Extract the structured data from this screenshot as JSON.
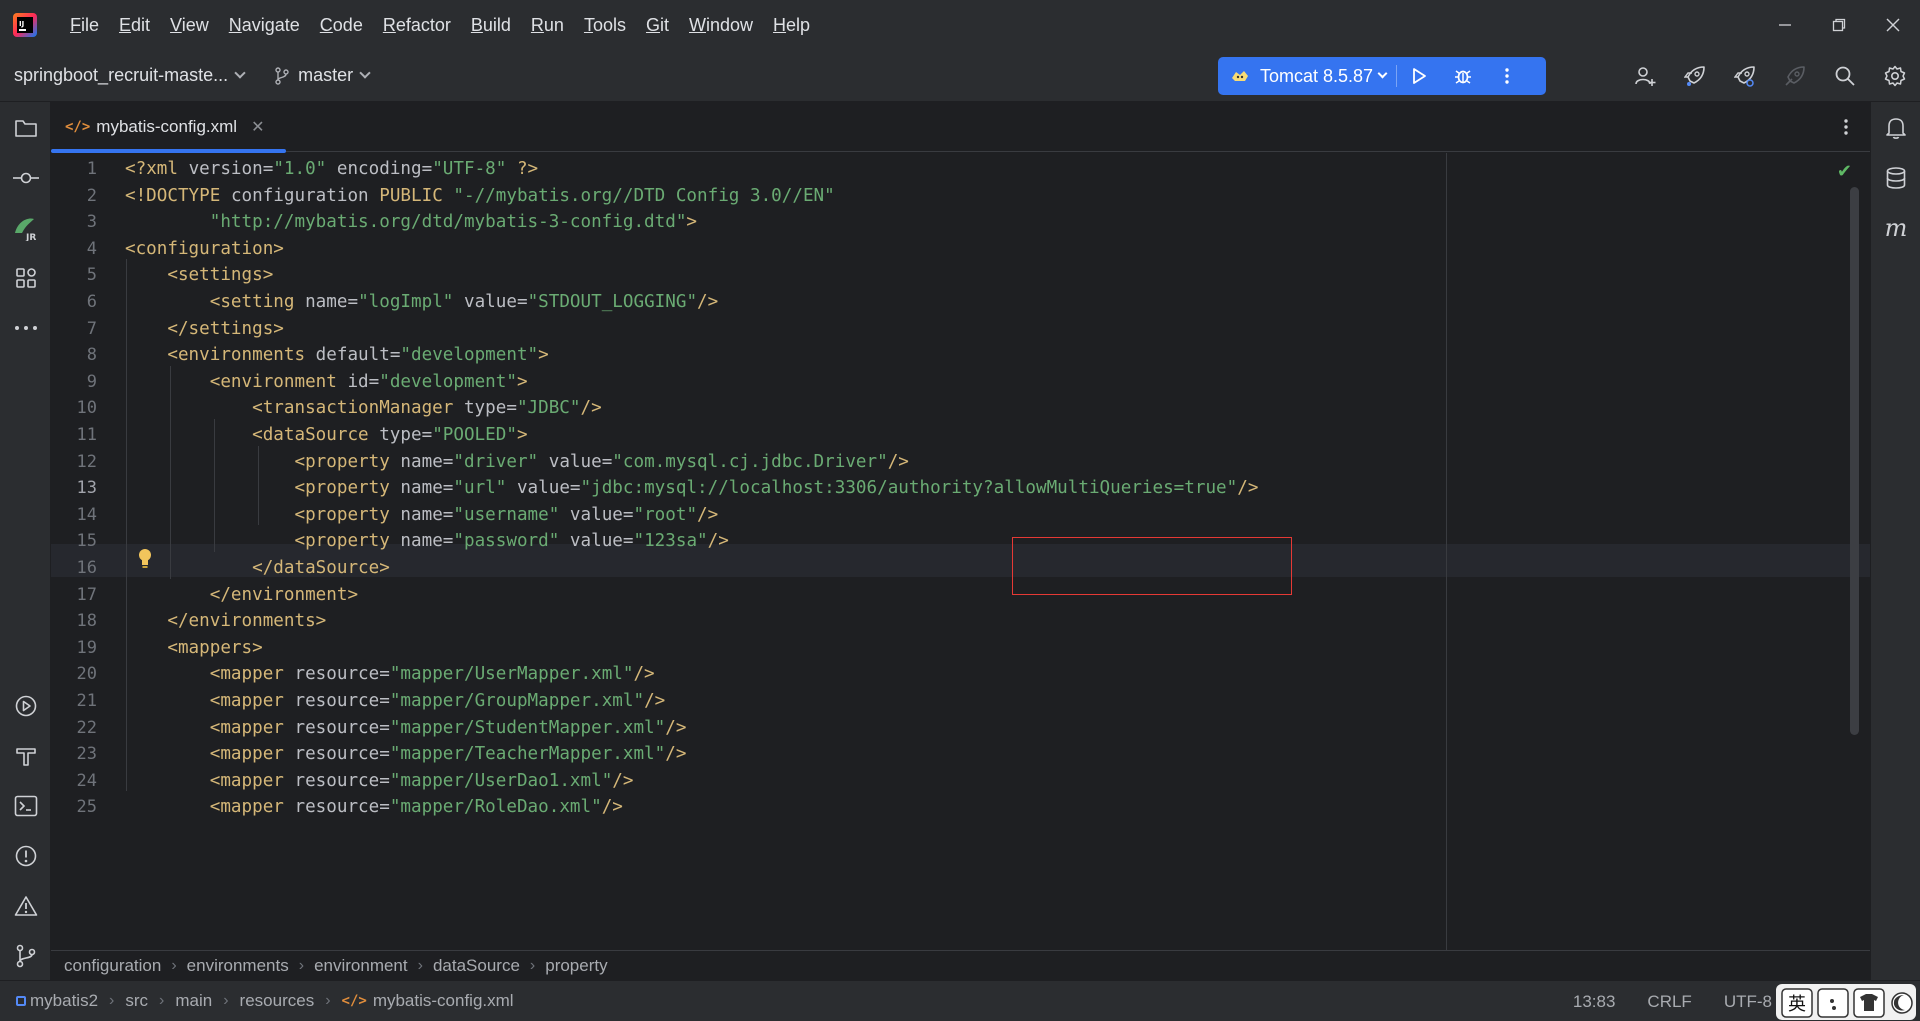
{
  "menu": {
    "items": [
      {
        "mnemonic": "F",
        "rest": "ile"
      },
      {
        "mnemonic": "E",
        "rest": "dit"
      },
      {
        "mnemonic": "V",
        "rest": "iew"
      },
      {
        "mnemonic": "N",
        "rest": "avigate"
      },
      {
        "mnemonic": "C",
        "rest": "ode"
      },
      {
        "mnemonic": "R",
        "rest": "efactor"
      },
      {
        "mnemonic": "B",
        "rest": "uild"
      },
      {
        "mnemonic": "R",
        "rest": "un"
      },
      {
        "mnemonic": "T",
        "rest": "ools"
      },
      {
        "mnemonic": "G",
        "rest": "it"
      },
      {
        "mnemonic": "W",
        "rest": "indow"
      },
      {
        "mnemonic": "H",
        "rest": "elp"
      }
    ]
  },
  "toolbar": {
    "project_name": "springboot_recruit-maste...",
    "branch": "master",
    "run_config": "Tomcat 8.5.87"
  },
  "tabs": {
    "active_label": "mybatis-config.xml"
  },
  "editor": {
    "current_line": 13,
    "code": [
      [
        [
          "pun",
          "<?"
        ],
        [
          "tag",
          "xml "
        ],
        [
          "attr",
          "version"
        ],
        [
          "txt",
          "="
        ],
        [
          "val",
          "\"1.0\""
        ],
        [
          "txt",
          " "
        ],
        [
          "attr",
          "encoding"
        ],
        [
          "txt",
          "="
        ],
        [
          "val",
          "\"UTF-8\""
        ],
        [
          "txt",
          " "
        ],
        [
          "pun",
          "?>"
        ]
      ],
      [
        [
          "tag",
          "<!DOCTYPE "
        ],
        [
          "txt",
          "configuration "
        ],
        [
          "tag",
          "PUBLIC "
        ],
        [
          "val",
          "\"-//mybatis.org//DTD Config 3.0//EN\""
        ]
      ],
      [
        [
          "txt",
          "        "
        ],
        [
          "val",
          "\"http://mybatis.org/dtd/mybatis-3-config.dtd\""
        ],
        [
          "tag",
          ">"
        ]
      ],
      [
        [
          "tag",
          "<configuration>"
        ]
      ],
      [
        [
          "txt",
          "    "
        ],
        [
          "tag",
          "<settings>"
        ]
      ],
      [
        [
          "txt",
          "        "
        ],
        [
          "tag",
          "<setting "
        ],
        [
          "attr",
          "name"
        ],
        [
          "txt",
          "="
        ],
        [
          "val",
          "\"logImpl\""
        ],
        [
          "txt",
          " "
        ],
        [
          "attr",
          "value"
        ],
        [
          "txt",
          "="
        ],
        [
          "val",
          "\"STDOUT_LOGGING\""
        ],
        [
          "tag",
          "/>"
        ]
      ],
      [
        [
          "txt",
          "    "
        ],
        [
          "tag",
          "</settings>"
        ]
      ],
      [
        [
          "txt",
          "    "
        ],
        [
          "tag",
          "<environments "
        ],
        [
          "attr",
          "default"
        ],
        [
          "txt",
          "="
        ],
        [
          "val",
          "\"development\""
        ],
        [
          "tag",
          ">"
        ]
      ],
      [
        [
          "txt",
          "        "
        ],
        [
          "tag",
          "<environment "
        ],
        [
          "attr",
          "id"
        ],
        [
          "txt",
          "="
        ],
        [
          "val",
          "\"development\""
        ],
        [
          "tag",
          ">"
        ]
      ],
      [
        [
          "txt",
          "            "
        ],
        [
          "tag",
          "<transactionManager "
        ],
        [
          "attr",
          "type"
        ],
        [
          "txt",
          "="
        ],
        [
          "val",
          "\"JDBC\""
        ],
        [
          "tag",
          "/>"
        ]
      ],
      [
        [
          "txt",
          "            "
        ],
        [
          "tag",
          "<dataSource "
        ],
        [
          "attr",
          "type"
        ],
        [
          "txt",
          "="
        ],
        [
          "val",
          "\"POOLED\""
        ],
        [
          "tag",
          ">"
        ]
      ],
      [
        [
          "txt",
          "                "
        ],
        [
          "tag",
          "<property "
        ],
        [
          "attr",
          "name"
        ],
        [
          "txt",
          "="
        ],
        [
          "val",
          "\"driver\""
        ],
        [
          "txt",
          " "
        ],
        [
          "attr",
          "value"
        ],
        [
          "txt",
          "="
        ],
        [
          "val",
          "\"com.mysql.cj.jdbc.Driver\""
        ],
        [
          "tag",
          "/>"
        ]
      ],
      [
        [
          "txt",
          "                "
        ],
        [
          "tag",
          "<property "
        ],
        [
          "attr",
          "name"
        ],
        [
          "txt",
          "="
        ],
        [
          "val",
          "\"url\""
        ],
        [
          "txt",
          " "
        ],
        [
          "attr",
          "value"
        ],
        [
          "txt",
          "="
        ],
        [
          "val",
          "\"jdbc:mysql://localhost:3306/authority?allowMultiQueries=true\""
        ],
        [
          "tag",
          "/>"
        ]
      ],
      [
        [
          "txt",
          "                "
        ],
        [
          "tag",
          "<property "
        ],
        [
          "attr",
          "name"
        ],
        [
          "txt",
          "="
        ],
        [
          "val",
          "\"username\""
        ],
        [
          "txt",
          " "
        ],
        [
          "attr",
          "value"
        ],
        [
          "txt",
          "="
        ],
        [
          "val",
          "\"root\""
        ],
        [
          "tag",
          "/>"
        ]
      ],
      [
        [
          "txt",
          "                "
        ],
        [
          "tag",
          "<property "
        ],
        [
          "attr",
          "name"
        ],
        [
          "txt",
          "="
        ],
        [
          "val",
          "\"password\""
        ],
        [
          "txt",
          " "
        ],
        [
          "attr",
          "value"
        ],
        [
          "txt",
          "="
        ],
        [
          "val",
          "\"123sa\""
        ],
        [
          "tag",
          "/>"
        ]
      ],
      [
        [
          "txt",
          "            "
        ],
        [
          "tag",
          "</dataSource>"
        ]
      ],
      [
        [
          "txt",
          "        "
        ],
        [
          "tag",
          "</environment>"
        ]
      ],
      [
        [
          "txt",
          "    "
        ],
        [
          "tag",
          "</environments>"
        ]
      ],
      [
        [
          "txt",
          "    "
        ],
        [
          "tag",
          "<mappers>"
        ]
      ],
      [
        [
          "txt",
          "        "
        ],
        [
          "tag",
          "<mapper "
        ],
        [
          "attr",
          "resource"
        ],
        [
          "txt",
          "="
        ],
        [
          "val",
          "\"mapper/UserMapper.xml\""
        ],
        [
          "tag",
          "/>"
        ]
      ],
      [
        [
          "txt",
          "        "
        ],
        [
          "tag",
          "<mapper "
        ],
        [
          "attr",
          "resource"
        ],
        [
          "txt",
          "="
        ],
        [
          "val",
          "\"mapper/GroupMapper.xml\""
        ],
        [
          "tag",
          "/>"
        ]
      ],
      [
        [
          "txt",
          "        "
        ],
        [
          "tag",
          "<mapper "
        ],
        [
          "attr",
          "resource"
        ],
        [
          "txt",
          "="
        ],
        [
          "val",
          "\"mapper/StudentMapper.xml\""
        ],
        [
          "tag",
          "/>"
        ]
      ],
      [
        [
          "txt",
          "        "
        ],
        [
          "tag",
          "<mapper "
        ],
        [
          "attr",
          "resource"
        ],
        [
          "txt",
          "="
        ],
        [
          "val",
          "\"mapper/TeacherMapper.xml\""
        ],
        [
          "tag",
          "/>"
        ]
      ],
      [
        [
          "txt",
          "        "
        ],
        [
          "tag",
          "<mapper "
        ],
        [
          "attr",
          "resource"
        ],
        [
          "txt",
          "="
        ],
        [
          "val",
          "\"mapper/UserDao1.xml\""
        ],
        [
          "tag",
          "/>"
        ]
      ],
      [
        [
          "txt",
          "        "
        ],
        [
          "tag",
          "<mapper "
        ],
        [
          "attr",
          "resource"
        ],
        [
          "txt",
          "="
        ],
        [
          "val",
          "\"mapper/RoleDao.xml\""
        ],
        [
          "tag",
          "/>"
        ]
      ]
    ]
  },
  "breadcrumbs": [
    "configuration",
    "environments",
    "environment",
    "dataSource",
    "property"
  ],
  "statusbar": {
    "path": [
      "mybatis2",
      "src",
      "main",
      "resources",
      "mybatis-config.xml"
    ],
    "caret": "13:83",
    "line_separator": "CRLF",
    "encoding": "UTF-8",
    "ime_label": "英"
  },
  "colors": {
    "accent": "#3574f0",
    "tag": "#d5b778",
    "string": "#6aab73",
    "highlight_box": "#e53935"
  },
  "icons": {
    "left_strip": [
      "folder-icon",
      "commit-icon",
      "jrebel-icon",
      "structure-icon",
      "more-icon",
      "services-icon",
      "build-icon",
      "terminal-icon",
      "problems-icon",
      "warning-icon",
      "git-icon"
    ],
    "right_strip": [
      "notifications-icon",
      "database-icon",
      "maven-icon"
    ],
    "toolbar_right": [
      "add-user-icon",
      "deploy-icon",
      "deploy-settings-icon",
      "deploy-disabled-icon",
      "search-icon",
      "settings-icon"
    ]
  }
}
